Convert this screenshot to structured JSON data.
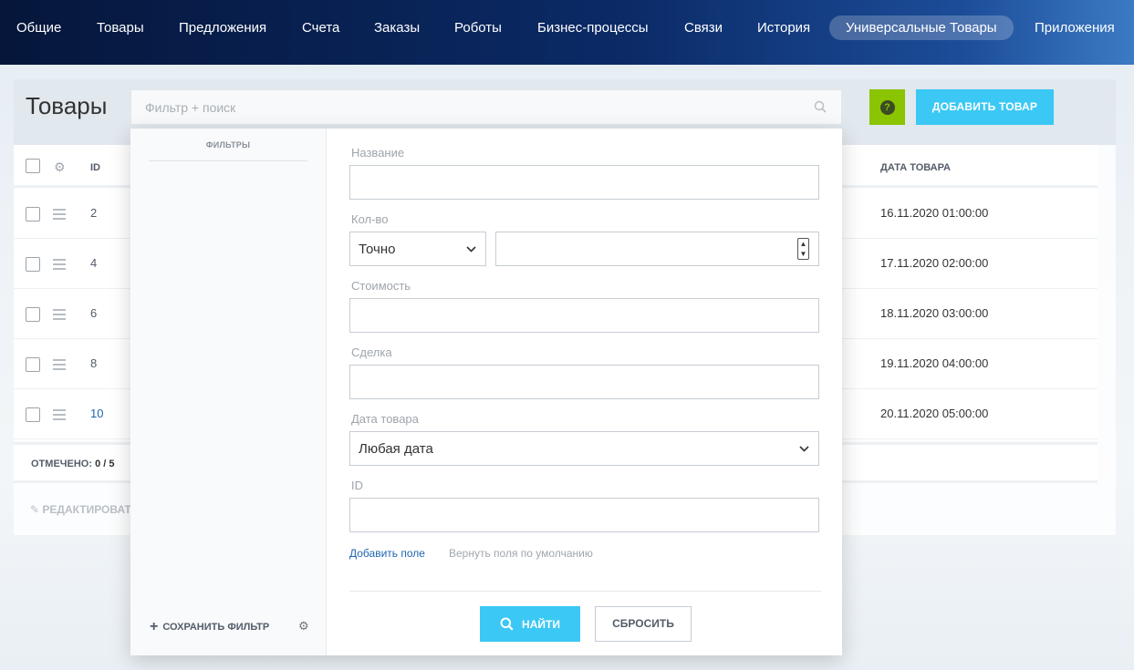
{
  "nav": {
    "items": [
      "Общие",
      "Товары",
      "Предложения",
      "Счета",
      "Заказы",
      "Роботы",
      "Бизнес-процессы",
      "Связи",
      "История",
      "Универсальные Товары",
      "Приложения"
    ],
    "active_index": 9
  },
  "page": {
    "title": "Товары",
    "add_button": "ДОБАВИТЬ ТОВАР",
    "help_icon": "question-icon"
  },
  "search": {
    "placeholder": "Фильтр + поиск"
  },
  "table": {
    "columns": {
      "id": "ID",
      "date": "ДАТА ТОВАРА"
    },
    "rows": [
      {
        "id": "2",
        "date": "16.11.2020 01:00:00"
      },
      {
        "id": "4",
        "date": "17.11.2020 02:00:00"
      },
      {
        "id": "6",
        "date": "18.11.2020 03:00:00"
      },
      {
        "id": "8",
        "date": "19.11.2020 04:00:00"
      },
      {
        "id": "10",
        "date": "20.11.2020 05:00:00"
      }
    ],
    "marked_label": "ОТМЕЧЕНО:",
    "marked_value": "0 / 5",
    "edit_label": "РЕДАКТИРОВАТ"
  },
  "filter": {
    "sidebar_caption": "ФИЛЬТРЫ",
    "save_filter": "СОХРАНИТЬ ФИЛЬТР",
    "fields": {
      "name_label": "Название",
      "qty_label": "Кол-во",
      "qty_mode": "Точно",
      "cost_label": "Стоимость",
      "deal_label": "Сделка",
      "date_label": "Дата товара",
      "date_value": "Любая дата",
      "id_label": "ID"
    },
    "add_field": "Добавить поле",
    "restore_fields": "Вернуть поля по умолчанию",
    "find_button": "НАЙТИ",
    "reset_button": "СБРОСИТЬ"
  }
}
